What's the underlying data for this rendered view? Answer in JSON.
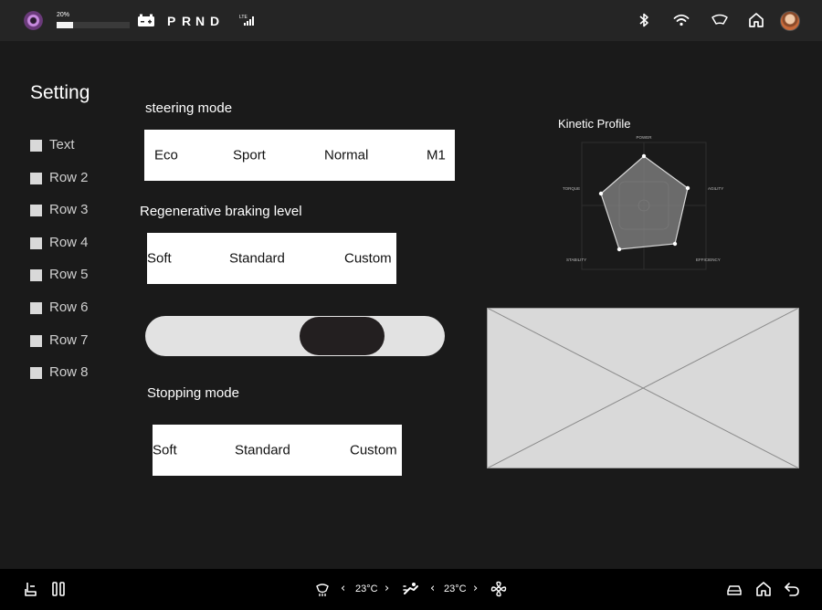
{
  "status_bar": {
    "battery_percent_label": "20%",
    "battery_level": 0.22,
    "gears": [
      "P",
      "R",
      "N",
      "D"
    ],
    "signal_label": "LTE",
    "icons": [
      "bluetooth-icon",
      "wifi-icon",
      "windshield-icon",
      "home-icon"
    ]
  },
  "sidebar": {
    "title": "Setting",
    "items": [
      {
        "label": "Text"
      },
      {
        "label": "Row 2"
      },
      {
        "label": "Row 3"
      },
      {
        "label": "Row 4"
      },
      {
        "label": "Row 5"
      },
      {
        "label": "Row 6"
      },
      {
        "label": "Row 7"
      },
      {
        "label": "Row 8"
      }
    ]
  },
  "steering": {
    "label": "steering mode",
    "options": [
      "Eco",
      "Sport",
      "Normal",
      "M1"
    ]
  },
  "regen": {
    "label": "Regenerative braking level",
    "options": [
      "Soft",
      "Standard",
      "Custom"
    ]
  },
  "slider": {
    "value": 0.72
  },
  "stopping": {
    "label": "Stopping mode",
    "options": [
      "Soft",
      "Standard",
      "Custom"
    ]
  },
  "radar": {
    "title": "Kinetic Profile",
    "axes": [
      "POWER",
      "AGILITY",
      "EFFICIENCY",
      "STABILITY",
      "TORQUE"
    ]
  },
  "bottom_bar": {
    "driver_temp": "23°C",
    "passenger_temp": "23°C",
    "icons": [
      "seat-icon",
      "panels-icon",
      "heated-steering-icon",
      "airflow-icon",
      "fan-icon",
      "car-icon",
      "home-icon",
      "back-icon"
    ]
  },
  "colors": {
    "background": "#1a1a1a",
    "topbar": "#252525",
    "bottombar": "#000000",
    "segment_bg": "#ffffff",
    "slider_track": "#e2e2e2",
    "slider_knob": "#231f20",
    "placeholder": "#d9d9d9"
  }
}
